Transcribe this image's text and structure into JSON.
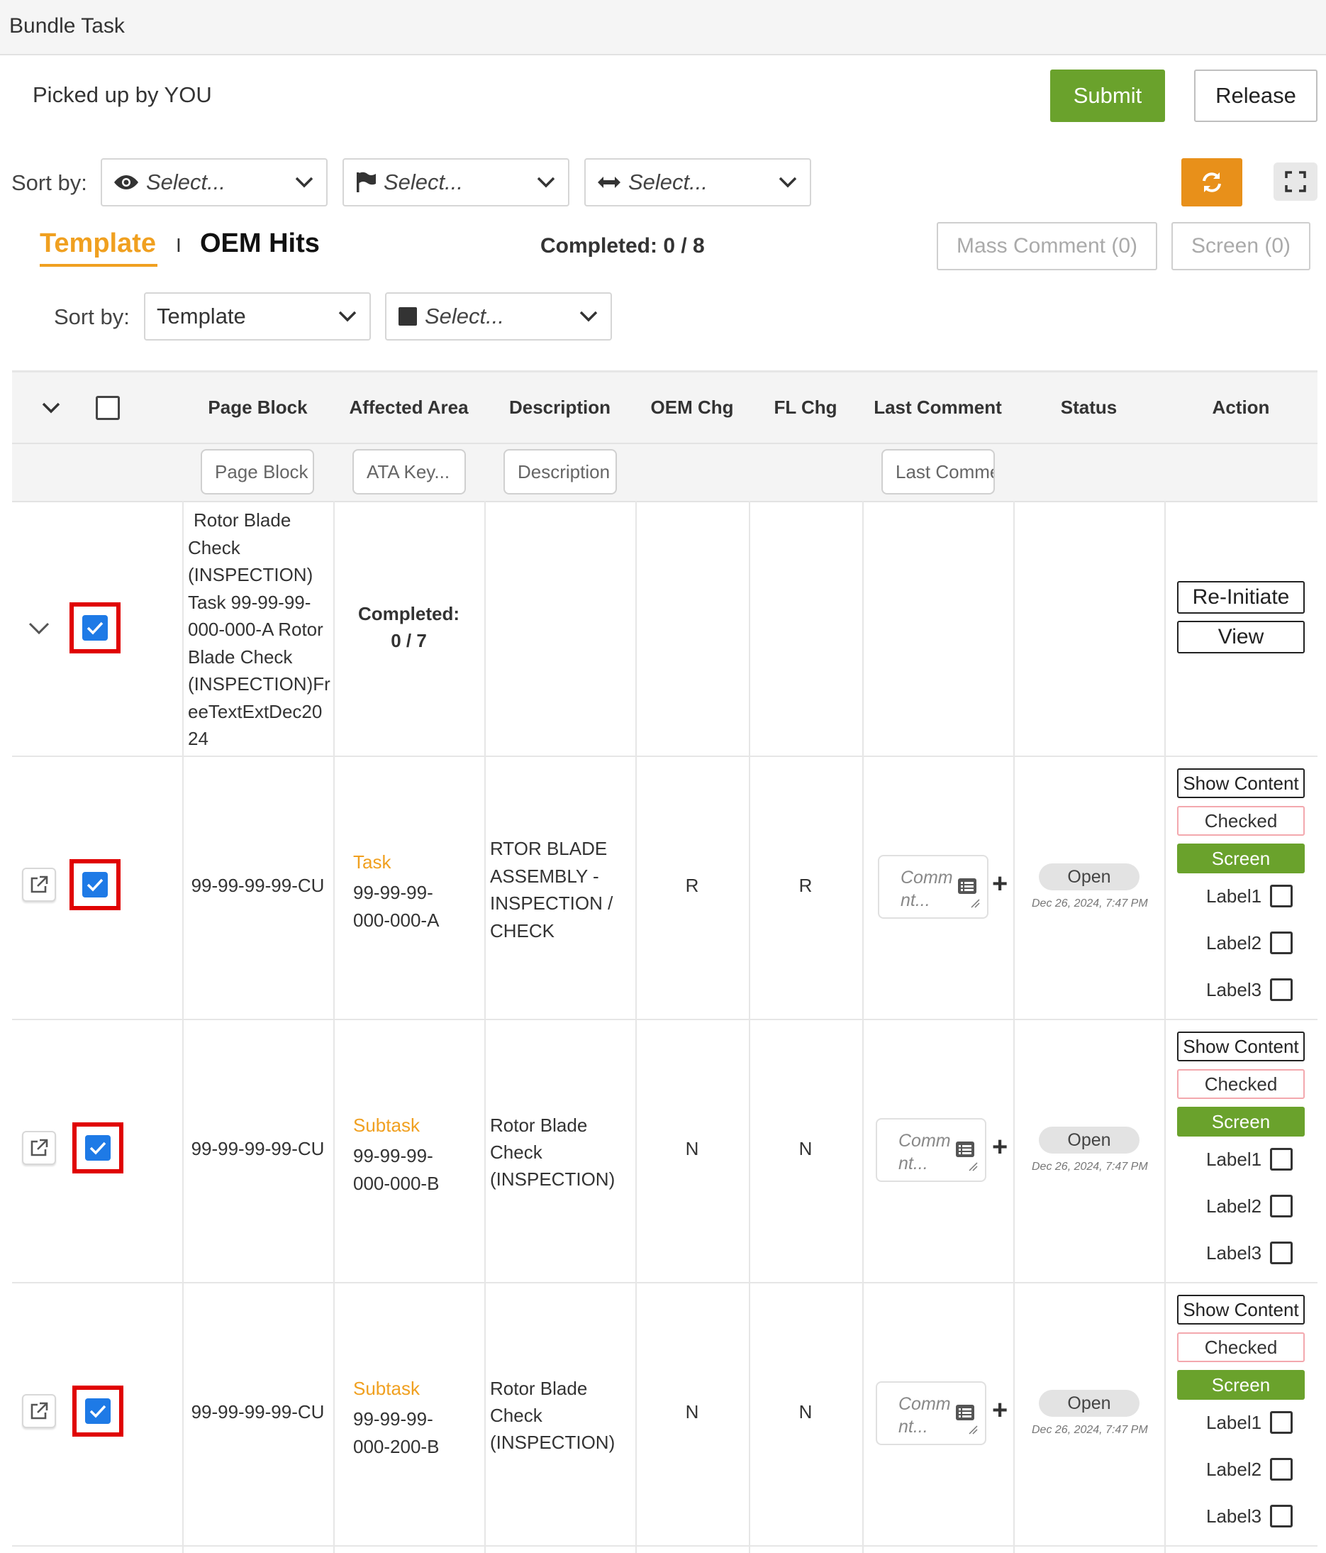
{
  "window": {
    "title": "Bundle Task"
  },
  "header": {
    "picked_up": "Picked up by YOU",
    "submit": "Submit",
    "release": "Release"
  },
  "sort_primary": {
    "label": "Sort by:",
    "selects": [
      {
        "icon": "eye-icon",
        "placeholder": "Select..."
      },
      {
        "icon": "flag-icon",
        "placeholder": "Select..."
      },
      {
        "icon": "arrows-horizontal-icon",
        "placeholder": "Select..."
      }
    ]
  },
  "tabs": {
    "template": "Template",
    "separator": "I",
    "oem_hits": "OEM Hits",
    "active": "Template"
  },
  "completed_summary": "Completed: 0 / 8",
  "mass_comment": "Mass Comment (0)",
  "screen_btn": "Screen (0)",
  "sort_secondary": {
    "label": "Sort by:",
    "selects": [
      {
        "value": "Template"
      },
      {
        "icon": "square-icon",
        "placeholder": "Select..."
      }
    ]
  },
  "table": {
    "columns": [
      "Page Block",
      "Affected Area",
      "Description",
      "OEM Chg",
      "FL Chg",
      "Last Comment",
      "Status",
      "Action"
    ],
    "filters": {
      "page_block": "Page Block",
      "ata_key": "ATA Key...",
      "description": "Description",
      "last_comment": "Last Comment"
    },
    "group_row": {
      "page_block": "Rotor Blade Check (INSPECTION) Task 99-99-99-000-000-A Rotor Blade Check (INSPECTION)FreeTextExtDec2024",
      "page_block_lines": [
        "Rotor Blade",
        "Check",
        "(INSPECTION)",
        "Task 99-99-99-",
        "000-000-A Rotor",
        "Blade Check",
        "(INSPECTION)Fr",
        "eeTextExtDec20",
        "24"
      ],
      "completed_label": "Completed:",
      "completed_value": "0 / 7",
      "actions": {
        "reinitiate": "Re-Initiate",
        "view": "View"
      }
    },
    "rows": [
      {
        "page_block": "99-99-99-99-CU",
        "area_type": "Task",
        "area_code_1": "99-99-99-",
        "area_code_2": "000-000-A",
        "description_lines": [
          "RTOR BLADE",
          "ASSEMBLY -",
          "INSPECTION /",
          "CHECK"
        ],
        "oem_chg": "R",
        "fl_chg": "R",
        "comment_placeholder_1": "Comm",
        "comment_placeholder_2": "nt...",
        "status": "Open",
        "status_date": "Dec 26, 2024, 7:47 PM"
      },
      {
        "page_block": "99-99-99-99-CU",
        "area_type": "Subtask",
        "area_code_1": "99-99-99-",
        "area_code_2": "000-000-B",
        "description_lines": [
          "Rotor Blade",
          "Check",
          "(INSPECTION)"
        ],
        "oem_chg": "N",
        "fl_chg": "N",
        "comment_placeholder_1": "Comm",
        "comment_placeholder_2": "nt...",
        "status": "Open",
        "status_date": "Dec 26, 2024, 7:47 PM"
      },
      {
        "page_block": "99-99-99-99-CU",
        "area_type": "Subtask",
        "area_code_1": "99-99-99-",
        "area_code_2": "000-200-B",
        "description_lines": [
          "Rotor Blade",
          "Check",
          "(INSPECTION)"
        ],
        "oem_chg": "N",
        "fl_chg": "N",
        "comment_placeholder_1": "Comm",
        "comment_placeholder_2": "nt...",
        "status": "Open",
        "status_date": "Dec 26, 2024, 7:47 PM"
      }
    ],
    "row_actions": {
      "show_content": "Show Content",
      "checked": "Checked",
      "screen": "Screen",
      "labels": [
        "Label1",
        "Label2",
        "Label3"
      ]
    }
  },
  "colors": {
    "green": "#6aa22c",
    "orange": "#e8901a",
    "accent": "#f0a020",
    "check_blue": "#1e7ae6",
    "highlight_red": "#e00000"
  }
}
